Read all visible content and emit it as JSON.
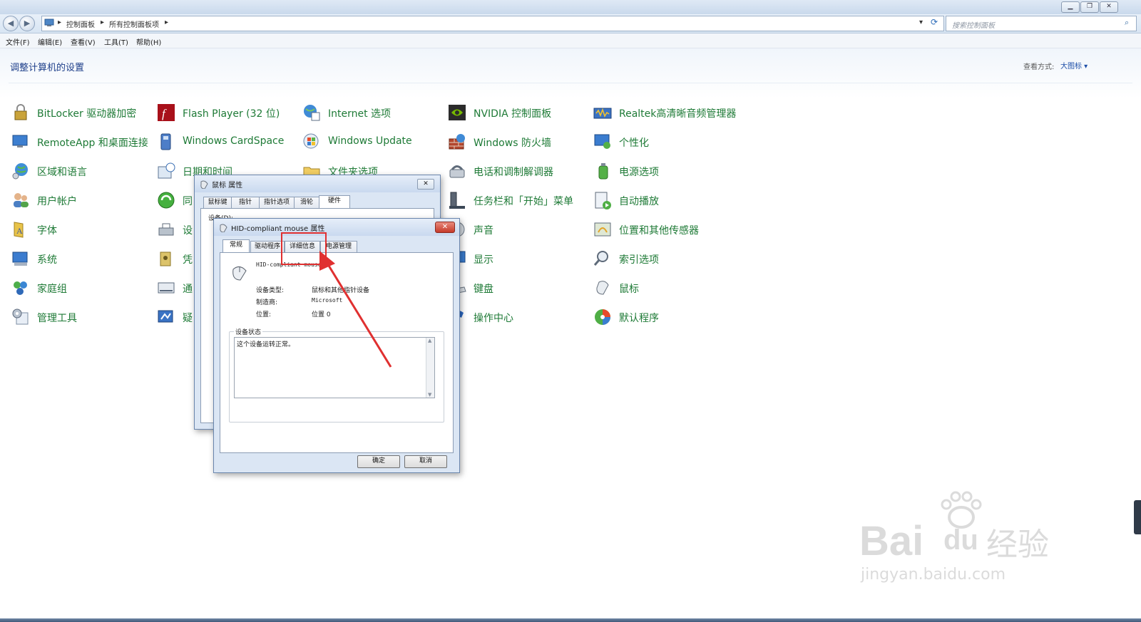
{
  "address_bar": {
    "path": [
      "控制面板",
      "所有控制面板项"
    ],
    "search_placeholder": "搜索控制面板"
  },
  "menu": [
    "文件(F)",
    "编辑(E)",
    "查看(V)",
    "工具(T)",
    "帮助(H)"
  ],
  "header": {
    "title": "调整计算机的设置",
    "view_label": "查看方式:",
    "view_value": "大图标 ▾"
  },
  "items": [
    {
      "label": "BitLocker 驱动器加密",
      "icon": "bitlocker-icon"
    },
    {
      "label": "RemoteApp 和桌面连接",
      "icon": "remoteapp-icon"
    },
    {
      "label": "区域和语言",
      "icon": "region-icon"
    },
    {
      "label": "用户帐户",
      "icon": "users-icon"
    },
    {
      "label": "字体",
      "icon": "fonts-icon"
    },
    {
      "label": "系统",
      "icon": "system-icon"
    },
    {
      "label": "家庭组",
      "icon": "homegroup-icon"
    },
    {
      "label": "管理工具",
      "icon": "admin-tools-icon"
    },
    {
      "label": "Flash Player (32 位)",
      "icon": "flash-icon"
    },
    {
      "label": "Windows CardSpace",
      "icon": "cardspace-icon"
    },
    {
      "label": "日期和时间",
      "icon": "datetime-icon"
    },
    {
      "label": "同",
      "icon": "sync-icon"
    },
    {
      "label": "设",
      "icon": "devices-icon"
    },
    {
      "label": "凭",
      "icon": "credential-icon"
    },
    {
      "label": "通",
      "icon": "notification-icon"
    },
    {
      "label": "疑",
      "icon": "troubleshoot-icon"
    },
    {
      "label": "Internet 选项",
      "icon": "internet-icon"
    },
    {
      "label": "Windows Update",
      "icon": "update-icon"
    },
    {
      "label": "文件夹选项",
      "icon": "folder-icon"
    },
    {
      "label": "NVIDIA 控制面板",
      "icon": "nvidia-icon"
    },
    {
      "label": "Windows 防火墙",
      "icon": "firewall-icon"
    },
    {
      "label": "电话和调制解调器",
      "icon": "phone-icon"
    },
    {
      "label": "任务栏和「开始」菜单",
      "icon": "taskbar-icon"
    },
    {
      "label": "声音",
      "icon": "sound-icon"
    },
    {
      "label": "显示",
      "icon": "display-icon"
    },
    {
      "label": "键盘",
      "icon": "keyboard-icon"
    },
    {
      "label": "操作中心",
      "icon": "flag-icon"
    },
    {
      "label": "Realtek高清晰音频管理器",
      "icon": "realtek-icon"
    },
    {
      "label": "个性化",
      "icon": "personalize-icon"
    },
    {
      "label": "电源选项",
      "icon": "power-icon"
    },
    {
      "label": "自动播放",
      "icon": "autoplay-icon"
    },
    {
      "label": "位置和其他传感器",
      "icon": "sensor-icon"
    },
    {
      "label": "索引选项",
      "icon": "index-icon"
    },
    {
      "label": "鼠标",
      "icon": "mouse-icon"
    },
    {
      "label": "默认程序",
      "icon": "default-programs-icon"
    }
  ],
  "mouse_dialog": {
    "title": "鼠标 属性",
    "tabs": [
      "鼠标键",
      "指针",
      "指针选项",
      "滑轮",
      "硬件"
    ],
    "devices_label": "设备(D):"
  },
  "hid_dialog": {
    "title": "HID-compliant mouse 属性",
    "tabs": [
      "常规",
      "驱动程序",
      "详细信息",
      "电源管理"
    ],
    "device_name": "HID-compliant mouse",
    "fields": [
      {
        "label": "设备类型:",
        "value": "鼠标和其他指针设备"
      },
      {
        "label": "制造商:",
        "value": "Microsoft"
      },
      {
        "label": "位置:",
        "value": "位置 0"
      }
    ],
    "status_label": "设备状态",
    "status_text": "这个设备运转正常。",
    "ok": "确定",
    "cancel": "取消"
  },
  "watermark": {
    "line1": "Bai",
    "line2": "du",
    "cn": "经验",
    "url": "jingyan.baidu.com"
  },
  "colors": {
    "link": "#1e7a36",
    "title": "#1e3f8a",
    "highlight": "#e03030"
  }
}
